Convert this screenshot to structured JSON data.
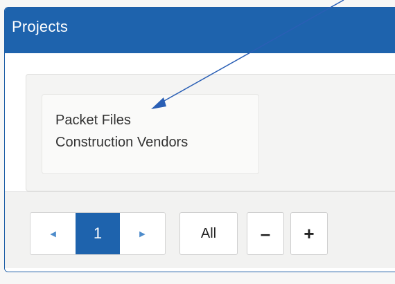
{
  "panel": {
    "title": "Projects"
  },
  "project_list": {
    "items": [
      {
        "label": "Packet Files"
      },
      {
        "label": "Construction Vendors"
      }
    ]
  },
  "pagination": {
    "prev_icon": "caret-left-icon",
    "next_icon": "caret-right-icon",
    "current_page": "1",
    "prev_glyph": "◀",
    "next_glyph": "▶"
  },
  "toolbar": {
    "all_label": "All",
    "collapse_label": "–",
    "expand_label": "+"
  },
  "colors": {
    "header_blue": "#1e63ad",
    "annotation_arrow": "#2a5fb5"
  }
}
